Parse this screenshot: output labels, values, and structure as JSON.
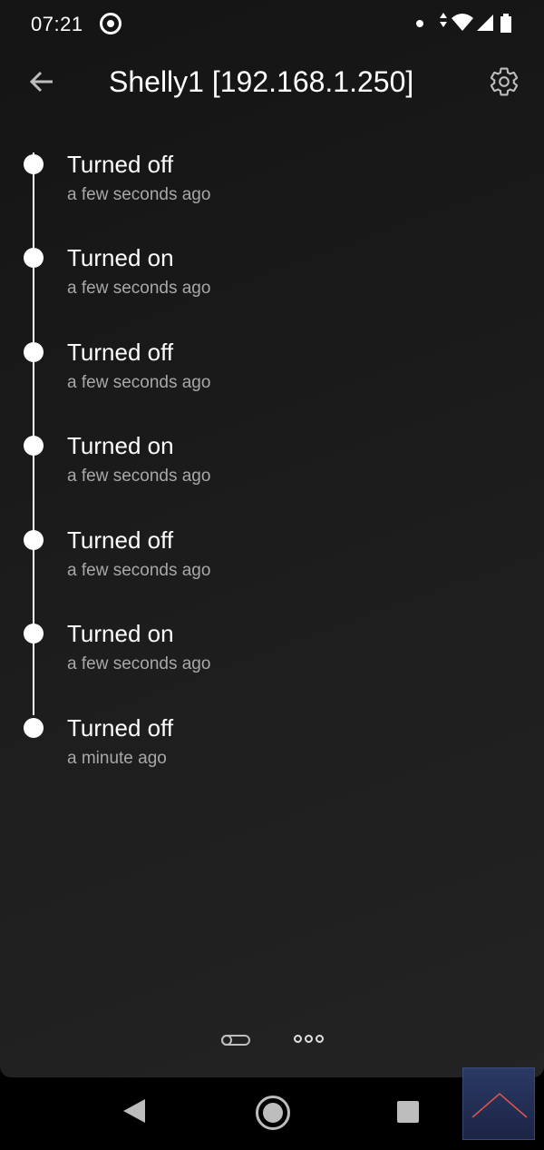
{
  "status_bar": {
    "time": "07:21"
  },
  "app_bar": {
    "title": "Shelly1 [192.168.1.250]",
    "back_icon": "arrow-left-icon",
    "settings_icon": "gear-icon"
  },
  "timeline": {
    "items": [
      {
        "title": "Turned off",
        "time": "a few seconds ago"
      },
      {
        "title": "Turned on",
        "time": "a few seconds ago"
      },
      {
        "title": "Turned off",
        "time": "a few seconds ago"
      },
      {
        "title": "Turned on",
        "time": "a few seconds ago"
      },
      {
        "title": "Turned off",
        "time": "a few seconds ago"
      },
      {
        "title": "Turned on",
        "time": "a few seconds ago"
      },
      {
        "title": "Turned off",
        "time": "a minute ago"
      }
    ]
  },
  "colors": {
    "background": "#1b1b1b",
    "text_primary": "#ffffff",
    "text_secondary": "#a8a8a8",
    "timeline_accent": "#ffffff"
  }
}
